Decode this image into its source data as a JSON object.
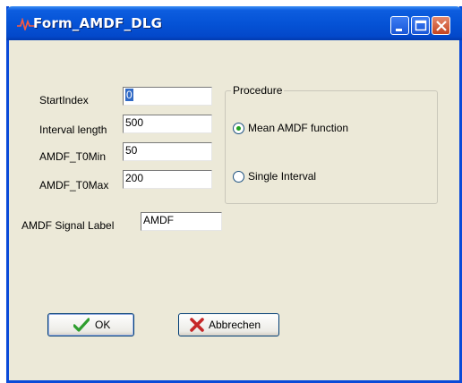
{
  "window": {
    "title": "Form_AMDF_DLG"
  },
  "fields": {
    "start_index": {
      "label": "StartIndex",
      "value": "0"
    },
    "interval_length": {
      "label": "Interval length",
      "value": "500"
    },
    "amdf_t0min": {
      "label": "AMDF_T0Min",
      "value": "50"
    },
    "amdf_t0max": {
      "label": "AMDF_T0Max",
      "value": "200"
    },
    "signal_label": {
      "label": "AMDF Signal Label",
      "value": "AMDF"
    }
  },
  "procedure": {
    "title": "Procedure",
    "options": [
      {
        "label": "Mean AMDF function",
        "selected": true
      },
      {
        "label": "Single Interval",
        "selected": false
      }
    ]
  },
  "buttons": {
    "ok": "OK",
    "cancel": "Abbrechen"
  },
  "icons": {
    "app": "waveform-icon",
    "ok": "checkmark-icon",
    "cancel": "x-cross-icon"
  },
  "colors": {
    "titlebar": "#0553D6",
    "dialog_bg": "#ECE9D8",
    "selection": "#316AC5",
    "ok_check": "#2E9E2E",
    "cancel_x": "#C62828"
  }
}
